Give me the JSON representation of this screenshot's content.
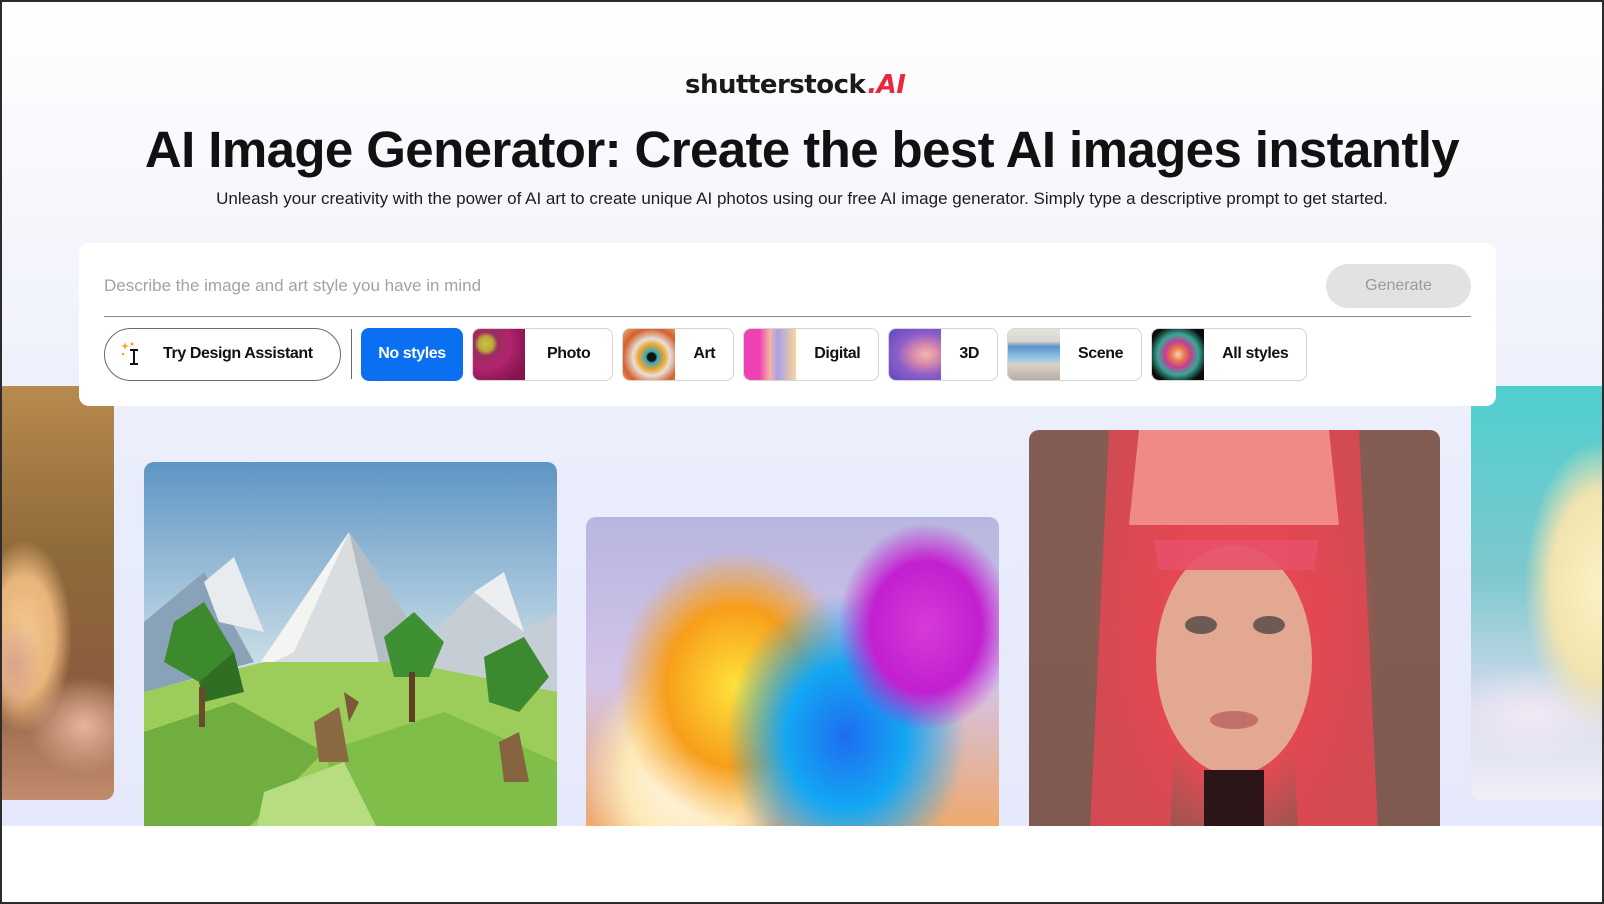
{
  "brand": {
    "name": "shutterstock",
    "suffix": ".AI",
    "accent_color": "#e8283d"
  },
  "header": {
    "title": "AI Image Generator: Create the best AI images instantly",
    "subtitle": "Unleash your creativity with the power of AI art to create unique AI photos using our free AI image generator. Simply type a descriptive prompt to get started."
  },
  "prompt": {
    "value": "",
    "placeholder": "Describe the image and art style you have in mind",
    "generate_label": "Generate"
  },
  "styles": {
    "assistant_label": "Try Design Assistant",
    "assistant_icon": "sparkle-cursor-icon",
    "selected": "No styles",
    "no_styles_label": "No styles",
    "no_styles_color": "#0a6ff0",
    "chips": [
      {
        "label": "Photo",
        "thumb": "pink-flower-thumbnail"
      },
      {
        "label": "Art",
        "thumb": "painted-eye-thumbnail"
      },
      {
        "label": "Digital",
        "thumb": "pink-sculpture-thumbnail"
      },
      {
        "label": "3D",
        "thumb": "purple-swirl-thumbnail"
      },
      {
        "label": "Scene",
        "thumb": "living-room-thumbnail"
      },
      {
        "label": "All styles",
        "thumb": "color-explosion-thumbnail"
      }
    ]
  },
  "gallery": {
    "images": [
      {
        "subject": "woman-face-with-glitter-makeup"
      },
      {
        "subject": "low-poly-mountain-landscape-with-deer"
      },
      {
        "subject": "rainbow-fluffy-fur"
      },
      {
        "subject": "woman-with-red-pink-hair-portrait"
      },
      {
        "subject": "fluffy-cat-on-clouds"
      }
    ]
  }
}
